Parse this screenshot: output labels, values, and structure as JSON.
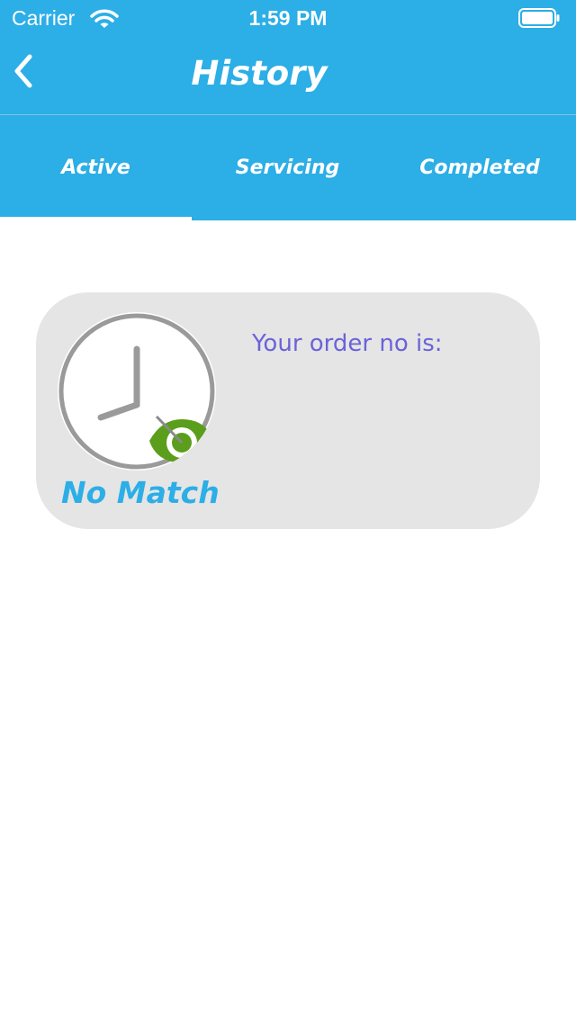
{
  "status_bar": {
    "carrier": "Carrier",
    "time": "1:59 PM"
  },
  "header": {
    "title": "History",
    "back_icon": "chevron-left-icon"
  },
  "tabs": [
    {
      "label": "Active",
      "selected": true
    },
    {
      "label": "Servicing",
      "selected": false
    },
    {
      "label": "Completed",
      "selected": false
    }
  ],
  "order_card": {
    "status": "No Match",
    "order_label": "Your order no is:",
    "image_icon": "clock-with-eye-icon"
  },
  "colors": {
    "primary": "#2caee6",
    "card_bg": "#e5e5e5",
    "order_text": "#6b63d9",
    "eye_green": "#5a9e1b"
  }
}
